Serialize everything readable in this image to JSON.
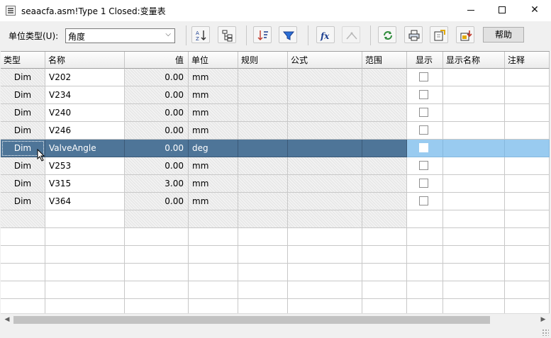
{
  "window": {
    "title": "seaacfa.asm!Type 1 Closed:变量表"
  },
  "toolbar": {
    "unit_type_label": "单位类型(U):",
    "unit_type_value": "角度",
    "help_label": "帮助",
    "icons": [
      "sort-icon",
      "tree-icon",
      "sort-order-icon",
      "filter-icon",
      "formula-icon",
      "disabled-formula-icon",
      "refresh-icon",
      "print-icon",
      "export-icon",
      "import-icon"
    ]
  },
  "grid": {
    "columns": [
      "类型",
      "名称",
      "值",
      "单位",
      "规则",
      "公式",
      "范围",
      "显示",
      "显示名称",
      "注释"
    ],
    "rows": [
      {
        "type": "Dim",
        "name": "V202",
        "value": "0.00",
        "unit": "mm"
      },
      {
        "type": "Dim",
        "name": "V234",
        "value": "0.00",
        "unit": "mm"
      },
      {
        "type": "Dim",
        "name": "V240",
        "value": "0.00",
        "unit": "mm"
      },
      {
        "type": "Dim",
        "name": "V246",
        "value": "0.00",
        "unit": "mm"
      },
      {
        "type": "Dim",
        "name": "ValveAngle",
        "value": "0.00",
        "unit": "deg"
      },
      {
        "type": "Dim",
        "name": "V253",
        "value": "0.00",
        "unit": "mm"
      },
      {
        "type": "Dim",
        "name": "V315",
        "value": "3.00",
        "unit": "mm"
      },
      {
        "type": "Dim",
        "name": "V364",
        "value": "0.00",
        "unit": "mm"
      }
    ],
    "selected_row": 4,
    "colors": {
      "selection_dark": "#4e7598",
      "selection_light": "#99cbf0"
    }
  }
}
